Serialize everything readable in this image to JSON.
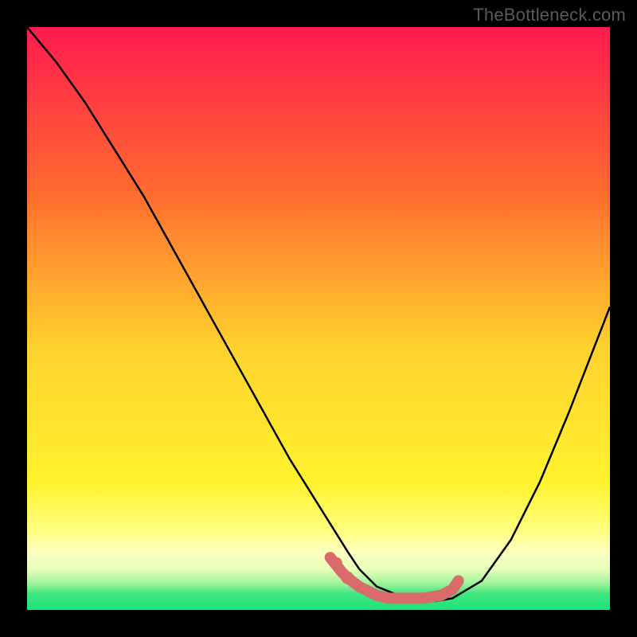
{
  "watermark": "TheBottleneck.com",
  "chart_data": {
    "type": "line",
    "title": "",
    "xlabel": "",
    "ylabel": "",
    "xlim": [
      0,
      100
    ],
    "ylim": [
      0,
      100
    ],
    "grid": false,
    "background_gradient": {
      "top": "#ff1a4f",
      "mid1": "#ff8a2a",
      "mid2": "#ffe733",
      "band": "#ffff9a",
      "bottom": "#19e57b"
    },
    "series": [
      {
        "name": "bottleneck-curve",
        "x": [
          0,
          5,
          10,
          15,
          20,
          25,
          30,
          35,
          40,
          45,
          50,
          55,
          57,
          60,
          65,
          70,
          73,
          78,
          83,
          88,
          93,
          100
        ],
        "y": [
          100,
          94,
          87,
          79,
          71,
          62,
          53,
          44,
          35,
          26,
          18,
          10,
          7,
          4,
          2,
          1.5,
          2,
          5,
          12,
          22,
          34,
          52
        ],
        "stroke": "#000000",
        "stroke_width": 2.5
      },
      {
        "name": "optimal-band-highlight",
        "x": [
          52,
          54,
          55,
          57,
          60,
          62,
          65,
          68,
          71,
          73,
          74
        ],
        "y": [
          9,
          6.5,
          5.5,
          4,
          2.5,
          2,
          2,
          2,
          2.5,
          3.5,
          5
        ],
        "stroke": "#d96b6b",
        "stroke_width": 14,
        "linecap": "round"
      }
    ],
    "markers": [
      {
        "x": 53,
        "y": 8,
        "r": 8,
        "fill": "#d96b6b"
      },
      {
        "x": 55,
        "y": 5.5,
        "r": 8,
        "fill": "#d96b6b"
      }
    ]
  }
}
